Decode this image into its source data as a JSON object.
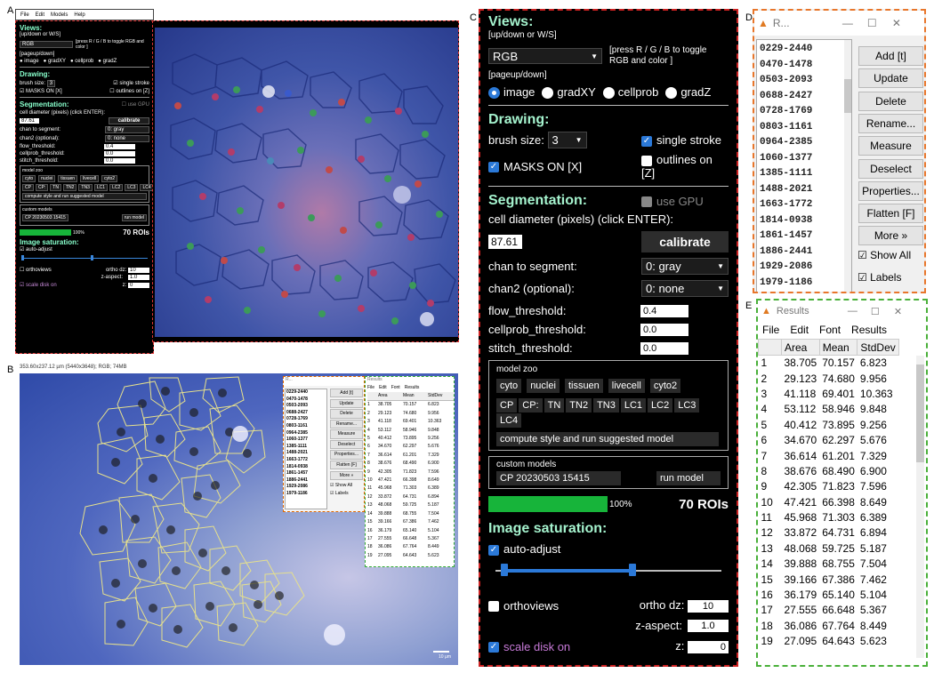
{
  "panel_labels": {
    "a": "A",
    "b": "B",
    "c": "C",
    "d": "D",
    "e": "E"
  },
  "menu": [
    "File",
    "Edit",
    "Models",
    "Help"
  ],
  "views": {
    "title": "Views:",
    "hint1": "[up/down or W/S]",
    "color_mode": "RGB",
    "press_hint": "[press R / G / B to toggle RGB and color ]",
    "hint2": "[pageup/down]",
    "radios": [
      "image",
      "gradXY",
      "cellprob",
      "gradZ"
    ]
  },
  "drawing": {
    "title": "Drawing:",
    "brush_label": "brush size:",
    "brush_value": "3",
    "single_stroke": "single stroke",
    "masks_on": "MASKS ON [X]",
    "outlines_on": "outlines on [Z]"
  },
  "segmentation": {
    "title": "Segmentation:",
    "use_gpu": "use GPU",
    "diameter_label": "cell diameter (pixels) (click ENTER):",
    "diameter_value": "87.61",
    "calibrate": "calibrate",
    "chan_label": "chan to segment:",
    "chan_value": "0: gray",
    "chan2_label": "chan2 (optional):",
    "chan2_value": "0: none",
    "flow_label": "flow_threshold:",
    "flow_value": "0.4",
    "cellprob_label": "cellprob_threshold:",
    "cellprob_value": "0.0",
    "stitch_label": "stitch_threshold:",
    "stitch_value": "0.0",
    "model_zoo_title": "model zoo",
    "zoo_row1": [
      "cyto",
      "nuclei",
      "tissuen",
      "livecell",
      "cyto2"
    ],
    "zoo_row2": [
      "CP",
      "CP:",
      "TN",
      "TN2",
      "TN3",
      "LC1",
      "LC2",
      "LC3",
      "LC4"
    ],
    "compute_style": "compute style and run suggested model",
    "custom_models_title": "custom models",
    "custom_model_value": "CP 20230503 15415",
    "run_model": "run model",
    "progress_percent": 100,
    "progress_text": "100%",
    "roi_count": "70 ROIs"
  },
  "saturation": {
    "title": "Image saturation:",
    "auto_adjust": "auto-adjust",
    "slider_low": 0.04,
    "slider_high": 0.6
  },
  "ortho": {
    "orthoviews": "orthoviews",
    "ortho_dz_label": "ortho dz:",
    "ortho_dz_value": "10",
    "z_aspect_label": "z-aspect:",
    "z_aspect_value": "1.0",
    "scale_disk": "scale disk on",
    "z_label": "z:",
    "z_value": "0"
  },
  "image_b_header": "353.60x237.12 µm (5440x3648); RGB; 74MB",
  "scale_bar_label": "10 µm",
  "roi_manager": {
    "title": "R...",
    "items": [
      "0229-2440",
      "0470-1478",
      "0503-2093",
      "0688-2427",
      "0728-1769",
      "0803-1161",
      "0964-2385",
      "1060-1377",
      "1385-1111",
      "1488-2021",
      "1663-1772",
      "1814-0938",
      "1861-1457",
      "1886-2441",
      "1929-2086",
      "1979-1186"
    ],
    "buttons": [
      "Add [t]",
      "Update",
      "Delete",
      "Rename...",
      "Measure",
      "Deselect",
      "Properties...",
      "Flatten [F]",
      "More »"
    ],
    "show_all": "Show All",
    "labels": "Labels"
  },
  "results": {
    "title": "Results",
    "menu": [
      "File",
      "Edit",
      "Font",
      "Results"
    ],
    "columns": [
      "",
      "Area",
      "Mean",
      "StdDev"
    ],
    "rows": [
      [
        "1",
        "38.705",
        "70.157",
        "6.823"
      ],
      [
        "2",
        "29.123",
        "74.680",
        "9.956"
      ],
      [
        "3",
        "41.118",
        "69.401",
        "10.363"
      ],
      [
        "4",
        "53.112",
        "58.946",
        "9.848"
      ],
      [
        "5",
        "40.412",
        "73.895",
        "9.256"
      ],
      [
        "6",
        "34.670",
        "62.297",
        "5.676"
      ],
      [
        "7",
        "36.614",
        "61.201",
        "7.329"
      ],
      [
        "8",
        "38.676",
        "68.490",
        "6.900"
      ],
      [
        "9",
        "42.305",
        "71.823",
        "7.596"
      ],
      [
        "10",
        "47.421",
        "66.398",
        "8.649"
      ],
      [
        "11",
        "45.968",
        "71.303",
        "6.389"
      ],
      [
        "12",
        "33.872",
        "64.731",
        "6.894"
      ],
      [
        "13",
        "48.068",
        "59.725",
        "5.187"
      ],
      [
        "14",
        "39.888",
        "68.755",
        "7.504"
      ],
      [
        "15",
        "39.166",
        "67.386",
        "7.462"
      ],
      [
        "16",
        "36.179",
        "65.140",
        "5.104"
      ],
      [
        "17",
        "27.555",
        "66.648",
        "5.367"
      ],
      [
        "18",
        "36.086",
        "67.764",
        "8.449"
      ],
      [
        "19",
        "27.095",
        "64.643",
        "5.623"
      ]
    ]
  }
}
